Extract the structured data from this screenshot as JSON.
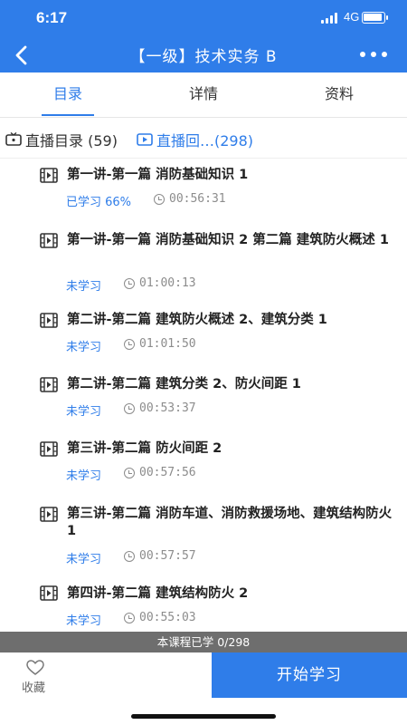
{
  "status_bar": {
    "time": "6:17",
    "network": "4G"
  },
  "nav": {
    "title": "【一级】技术实务 B"
  },
  "tabs": [
    {
      "label": "目录",
      "active": true
    },
    {
      "label": "详情",
      "active": false
    },
    {
      "label": "资料",
      "active": false
    }
  ],
  "filters": {
    "live_catalog": "直播目录 (59)",
    "replay": "直播回…(298)"
  },
  "lessons": [
    {
      "title": "第一讲-第一篇 消防基础知识 1",
      "status": "已学习 66%",
      "duration": "00:56:31"
    },
    {
      "title": "第一讲-第一篇 消防基础知识 2 第二篇 建筑防火概述 1",
      "status": "未学习",
      "duration": "01:00:13"
    },
    {
      "title": "第二讲-第二篇 建筑防火概述 2、建筑分类 1",
      "status": "未学习",
      "duration": "01:01:50"
    },
    {
      "title": "第二讲-第二篇 建筑分类 2、防火间距 1",
      "status": "未学习",
      "duration": "00:53:37"
    },
    {
      "title": "第三讲-第二篇 防火间距 2",
      "status": "未学习",
      "duration": "00:57:56"
    },
    {
      "title": "第三讲-第二篇 消防车道、消防救援场地、建筑结构防火 1",
      "status": "未学习",
      "duration": "00:57:57"
    },
    {
      "title": "第四讲-第二篇 建筑结构防火 2",
      "status": "未学习",
      "duration": "00:55:03"
    }
  ],
  "footer": {
    "progress_text": "本课程已学 0/298",
    "favorite_label": "收藏",
    "start_label": "开始学习"
  },
  "colors": {
    "primary": "#2f7de9",
    "progress_bg": "#6e6e6e",
    "muted": "#8c8c8c"
  }
}
